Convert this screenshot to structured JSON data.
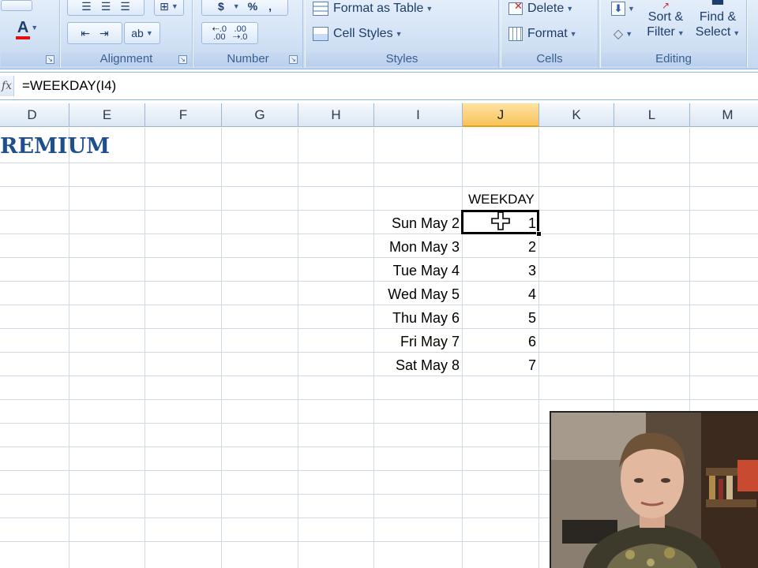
{
  "ribbon": {
    "groups": {
      "alignment": "Alignment",
      "number": "Number",
      "styles": "Styles",
      "cells": "Cells",
      "editing": "Editing"
    },
    "font_color_letter": "A",
    "number_buttons": {
      "currency": "$",
      "percent": "%",
      "comma": ",",
      "increase_decimal": "←.0\n.00",
      "decrease_decimal": ".00\n→.0"
    },
    "styles": {
      "format_as_table": "Format as Table",
      "cell_styles": "Cell Styles"
    },
    "cells": {
      "delete": "Delete",
      "format": "Format"
    },
    "editing": {
      "sort_filter_line1": "Sort &",
      "sort_filter_line2": "Filter",
      "find_select_line1": "Find &",
      "find_select_line2": "Select"
    },
    "colors": {
      "font_color_bar": "#e01010"
    }
  },
  "formula_bar": {
    "fx_label": "fx",
    "formula": "=WEEKDAY(I4)"
  },
  "columns": [
    "D",
    "E",
    "F",
    "G",
    "H",
    "I",
    "J",
    "K",
    "L",
    "M"
  ],
  "selected_column": "J",
  "sheet": {
    "title": "REMIUM",
    "header_weekday": "WEEKDAY",
    "rows": [
      {
        "date": "Sun May 2",
        "weekday": "1"
      },
      {
        "date": "Mon May 3",
        "weekday": "2"
      },
      {
        "date": "Tue May 4",
        "weekday": "3"
      },
      {
        "date": "Wed May 5",
        "weekday": "4"
      },
      {
        "date": "Thu May 6",
        "weekday": "5"
      },
      {
        "date": "Fri May 7",
        "weekday": "6"
      },
      {
        "date": "Sat May 8",
        "weekday": "7"
      }
    ]
  },
  "icons": {
    "cursor": "plus-cursor-icon",
    "sort": "sort-icon",
    "find": "binoculars-icon",
    "fill": "fill-down-icon",
    "clear": "eraser-icon"
  }
}
